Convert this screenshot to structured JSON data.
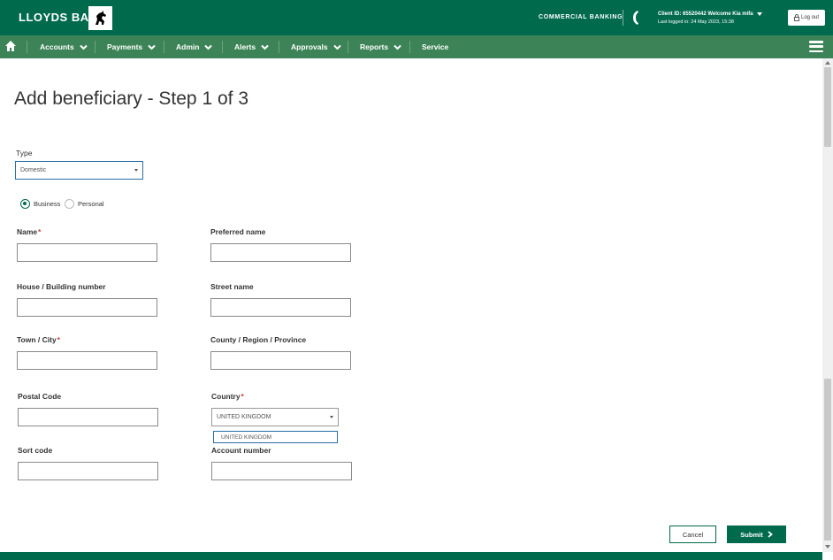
{
  "header": {
    "brand": "LLOYDS BANK",
    "section": "COMMERCIAL BANKING",
    "client_line": "Client ID: 65520442   Welcome Kia mifa",
    "last_logged": "Last logged in: 24 May 2023, 15:38",
    "logout_label": "Log out"
  },
  "nav": {
    "items": [
      {
        "label": "Accounts"
      },
      {
        "label": "Payments"
      },
      {
        "label": "Admin"
      },
      {
        "label": "Alerts"
      },
      {
        "label": "Approvals"
      },
      {
        "label": "Reports"
      },
      {
        "label": "Service"
      }
    ]
  },
  "page": {
    "title": "Add beneficiary - Step 1 of 3"
  },
  "form": {
    "type_label": "Type",
    "type_value": "Domestic",
    "radio_business": "Business",
    "radio_personal": "Personal",
    "name_label": "Name",
    "preferred_name_label": "Preferred name",
    "house_label": "House / Building number",
    "street_label": "Street name",
    "town_label": "Town / City",
    "county_label": "County / Region / Province",
    "postal_label": "Postal Code",
    "country_label": "Country",
    "country_value": "UNITED KINGDOM",
    "country_option": "UNITED KINGDOM",
    "sort_code_label": "Sort code",
    "account_number_label": "Account number",
    "required_mark": "*"
  },
  "actions": {
    "cancel": "Cancel",
    "submit": "Submit"
  },
  "colors": {
    "brand_green": "#006a4d",
    "nav_green": "#3c8457",
    "required_red": "#c0392b"
  }
}
